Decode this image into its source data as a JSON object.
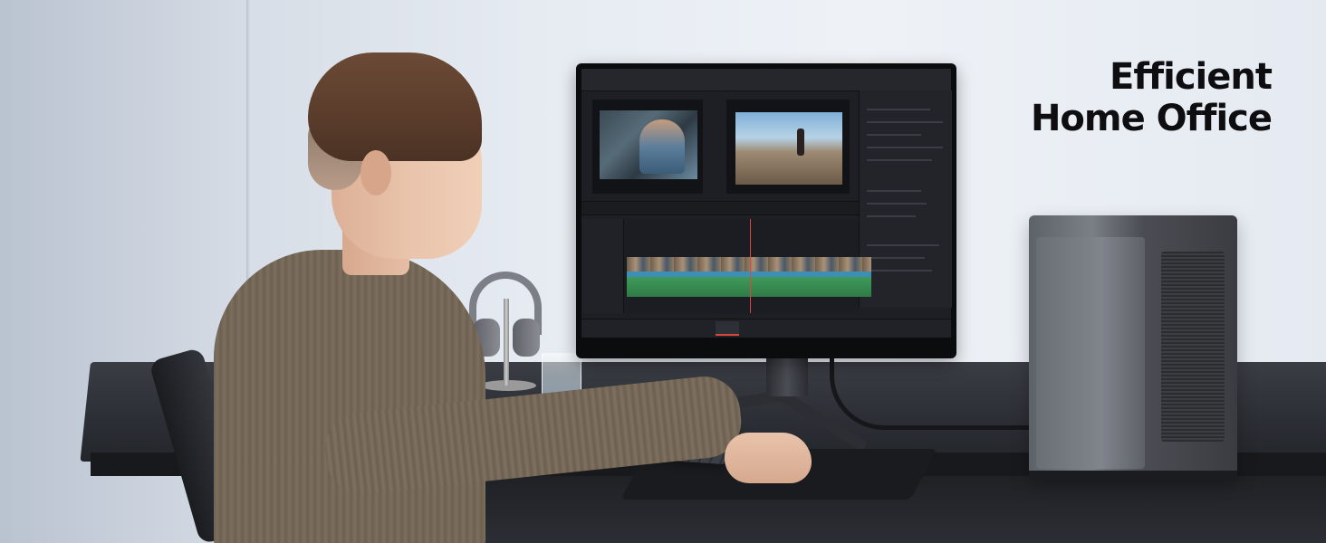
{
  "headline": {
    "line1": "Efficient",
    "line2": "Home Office"
  },
  "colors": {
    "headline": "#0e0e10",
    "wall": "#e6ebf2",
    "desk": "#2b2e34",
    "timeline_video": "#3e8fb6",
    "timeline_audio": "#3f9a5a",
    "playhead": "#e0443a"
  }
}
